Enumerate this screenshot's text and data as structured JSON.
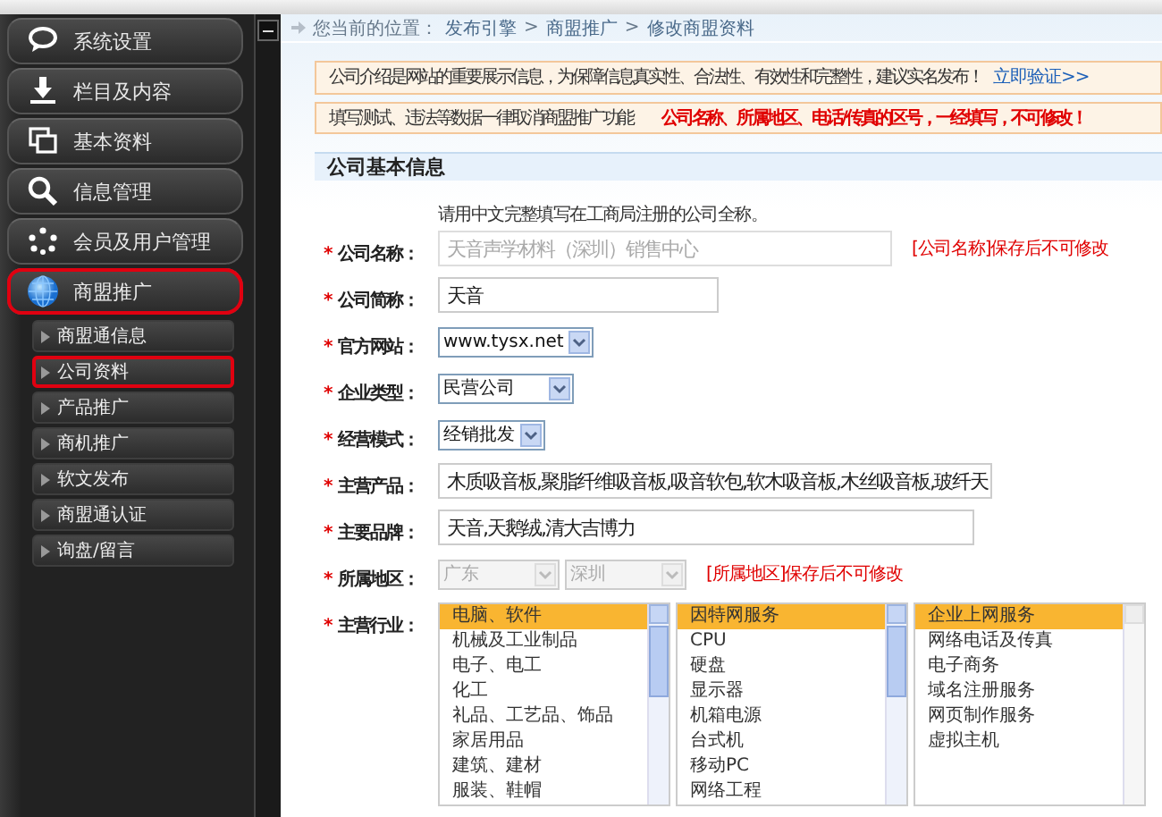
{
  "sidebar": {
    "menu": [
      {
        "label": "系统设置",
        "highlighted": false
      },
      {
        "label": "栏目及内容",
        "highlighted": false
      },
      {
        "label": "基本资料",
        "highlighted": false
      },
      {
        "label": "信息管理",
        "highlighted": false
      },
      {
        "label": "会员及用户管理",
        "highlighted": false
      },
      {
        "label": "商盟推广",
        "highlighted": true,
        "children": [
          {
            "label": "商盟通信息",
            "highlighted": false
          },
          {
            "label": "公司资料",
            "highlighted": true
          },
          {
            "label": "产品推广",
            "highlighted": false
          },
          {
            "label": "商机推广",
            "highlighted": false
          },
          {
            "label": "软文发布",
            "highlighted": false
          },
          {
            "label": "商盟通认证",
            "highlighted": false
          },
          {
            "label": "询盘/留言",
            "highlighted": false
          }
        ]
      }
    ]
  },
  "breadcrumb": {
    "prefix": "您当前的位置：",
    "items": [
      {
        "kind": "link",
        "text": "发布引擎"
      },
      {
        "kind": "separator",
        "text": ">"
      },
      {
        "kind": "link",
        "text": "商盟推广"
      },
      {
        "kind": "separator",
        "text": ">"
      },
      {
        "kind": "link",
        "text": "修改商盟资料"
      }
    ]
  },
  "notices": [
    {
      "text": "公司介绍是网站的重要展示信息，为保障信息真实性、合法性、有效性和完整性，建议实名发布！",
      "link": "立即验证>>"
    },
    {
      "text": "填写测试、违法等数据一律取消商盟推广功能",
      "alert": "公司名称、所属地区、电话/传真的区号，一经填写，不可修改！"
    }
  ],
  "section": {
    "title": "公司基本信息",
    "fields": [
      {
        "kind": "text",
        "mark": "*",
        "label": "公司名称：",
        "hint": "请用中文完整填写在工商局注册的公司全称。",
        "value": "天音声学材料（深圳）销售中心",
        "disabled": true,
        "note": "[公司名称]保存后不可修改"
      },
      {
        "kind": "text",
        "mark": "*",
        "label": "公司简称：",
        "value": "天音",
        "disabled": false
      },
      {
        "kind": "select",
        "mark": "*",
        "label": "官方网站：",
        "value": "www.tysx.net",
        "disabled": false
      },
      {
        "kind": "select",
        "mark": "*",
        "label": "企业类型：",
        "value": "民营公司",
        "disabled": false
      },
      {
        "kind": "select",
        "mark": "*",
        "label": "经营模式：",
        "value": "经销批发",
        "disabled": false
      },
      {
        "kind": "text",
        "mark": "*",
        "label": "主营产品：",
        "value": "木质吸音板,聚脂纤维吸音板,吸音软包,软木吸音板,木丝吸音板,玻纤天",
        "disabled": false
      },
      {
        "kind": "text",
        "mark": "*",
        "label": "主要品牌：",
        "value": "天音,天鹅绒,清大吉博力",
        "disabled": false
      },
      {
        "kind": "region",
        "mark": "*",
        "label": "所属地区：",
        "selects": [
          {
            "value": "广东",
            "disabled": true
          },
          {
            "value": "深圳",
            "disabled": true
          }
        ],
        "note": "[所属地区]保存后不可修改"
      },
      {
        "kind": "listboxes",
        "mark": "*",
        "label": "主营行业：",
        "lists": [
          {
            "items": [
              {
                "label": "电脑、软件",
                "selected": true
              },
              {
                "label": "机械及工业制品",
                "selected": false
              },
              {
                "label": "电子、电工",
                "selected": false
              },
              {
                "label": "化工",
                "selected": false
              },
              {
                "label": "礼品、工艺品、饰品",
                "selected": false
              },
              {
                "label": "家居用品",
                "selected": false
              },
              {
                "label": "建筑、建材",
                "selected": false
              },
              {
                "label": "服装、鞋帽",
                "selected": false
              }
            ]
          },
          {
            "items": [
              {
                "label": "因特网服务",
                "selected": true
              },
              {
                "label": "CPU",
                "selected": false
              },
              {
                "label": "硬盘",
                "selected": false
              },
              {
                "label": "显示器",
                "selected": false
              },
              {
                "label": "机箱电源",
                "selected": false
              },
              {
                "label": "台式机",
                "selected": false
              },
              {
                "label": "移动PC",
                "selected": false
              },
              {
                "label": "网络工程",
                "selected": false
              }
            ]
          },
          {
            "items": [
              {
                "label": "企业上网服务",
                "selected": true
              },
              {
                "label": "网络电话及传真",
                "selected": false
              },
              {
                "label": "电子商务",
                "selected": false
              },
              {
                "label": "域名注册服务",
                "selected": false
              },
              {
                "label": "网页制作服务",
                "selected": false
              },
              {
                "label": "虚拟主机",
                "selected": false
              }
            ]
          }
        ]
      }
    ]
  }
}
